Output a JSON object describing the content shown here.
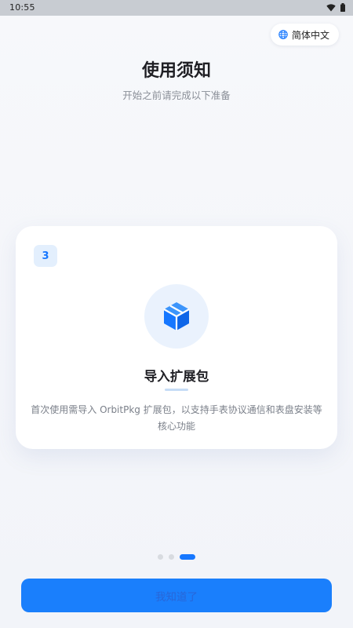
{
  "status_bar": {
    "time": "10:55",
    "icons": [
      "wifi-icon",
      "battery-icon"
    ]
  },
  "language": {
    "label": "简体中文",
    "icon": "globe-icon"
  },
  "header": {
    "title": "使用须知",
    "subtitle": "开始之前请完成以下准备"
  },
  "card": {
    "step_number": "3",
    "icon": "package-box-icon",
    "title": "导入扩展包",
    "description": "首次使用需导入 OrbitPkg 扩展包，以支持手表协议通信和表盘安装等核心功能"
  },
  "pagination": {
    "total": 3,
    "current": 3
  },
  "action": {
    "button_label": "我知道了"
  },
  "colors": {
    "accent": "#1677ff",
    "button": "#1a7ffc",
    "badge_bg": "#e3effd",
    "icon_bg": "#eaf2fd"
  }
}
